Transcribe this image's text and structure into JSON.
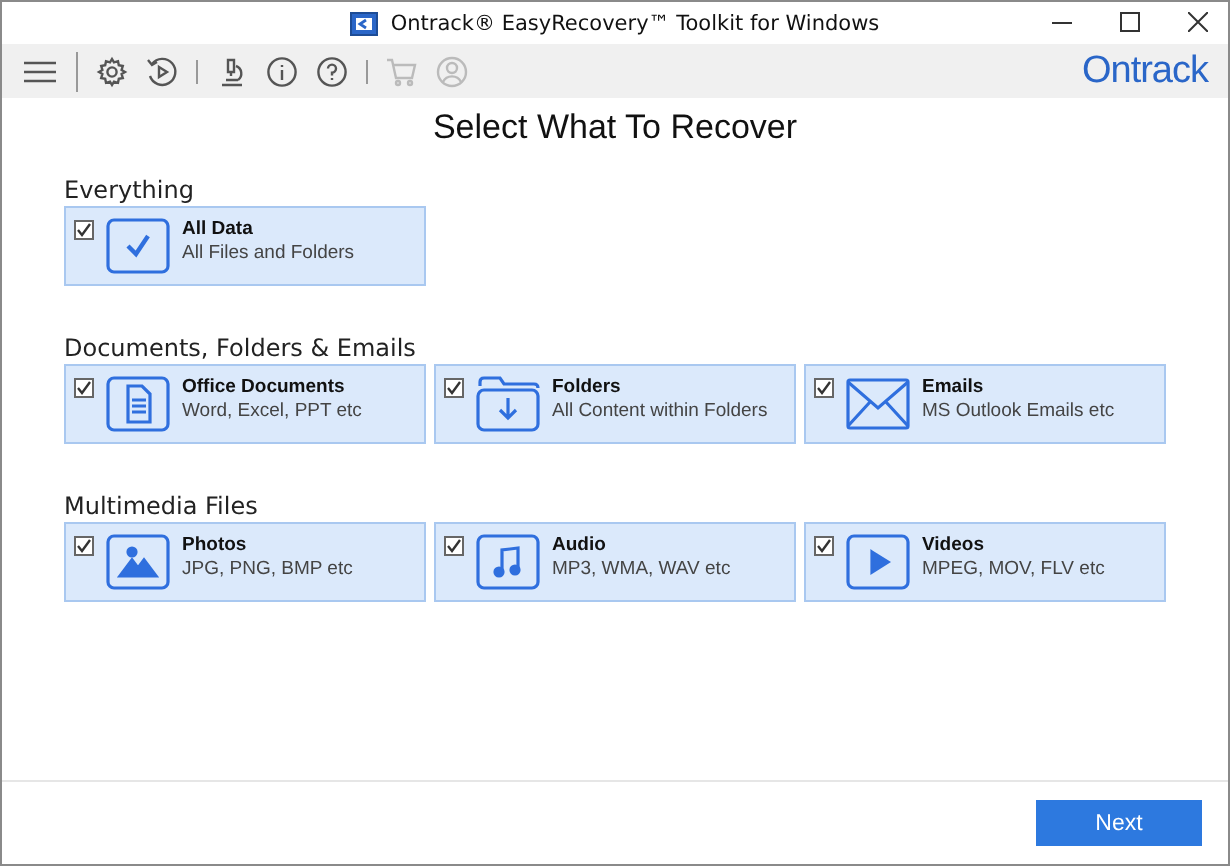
{
  "window": {
    "title": "Ontrack® EasyRecovery™ Toolkit for Windows"
  },
  "toolbar": {
    "items": [
      {
        "kind": "menu",
        "disabled": false
      },
      {
        "kind": "gear",
        "disabled": false
      },
      {
        "kind": "history",
        "disabled": false
      },
      {
        "kind": "microscope",
        "disabled": false
      },
      {
        "kind": "info",
        "disabled": false
      },
      {
        "kind": "help",
        "disabled": false
      },
      {
        "kind": "cart",
        "disabled": true
      },
      {
        "kind": "user",
        "disabled": true
      }
    ],
    "logo": "Ontrack"
  },
  "heading": "Select What To Recover",
  "sections": [
    {
      "title": "Everything",
      "options": [
        {
          "kind": "check",
          "label": "All Data",
          "description": "All Files and Folders",
          "checked": true
        }
      ]
    },
    {
      "title": "Documents, Folders & Emails",
      "options": [
        {
          "kind": "document",
          "label": "Office Documents",
          "description": "Word, Excel, PPT etc",
          "checked": true
        },
        {
          "kind": "folder",
          "label": "Folders",
          "description": "All Content within Folders",
          "checked": true
        },
        {
          "kind": "mail",
          "label": "Emails",
          "description": "MS Outlook Emails etc",
          "checked": true
        }
      ]
    },
    {
      "title": "Multimedia Files",
      "options": [
        {
          "kind": "photo",
          "label": "Photos",
          "description": "JPG, PNG, BMP etc",
          "checked": true
        },
        {
          "kind": "music",
          "label": "Audio",
          "description": "MP3, WMA, WAV etc",
          "checked": true
        },
        {
          "kind": "play",
          "label": "Videos",
          "description": "MPEG, MOV, FLV etc",
          "checked": true
        }
      ]
    }
  ],
  "buttons": [
    "Next"
  ]
}
